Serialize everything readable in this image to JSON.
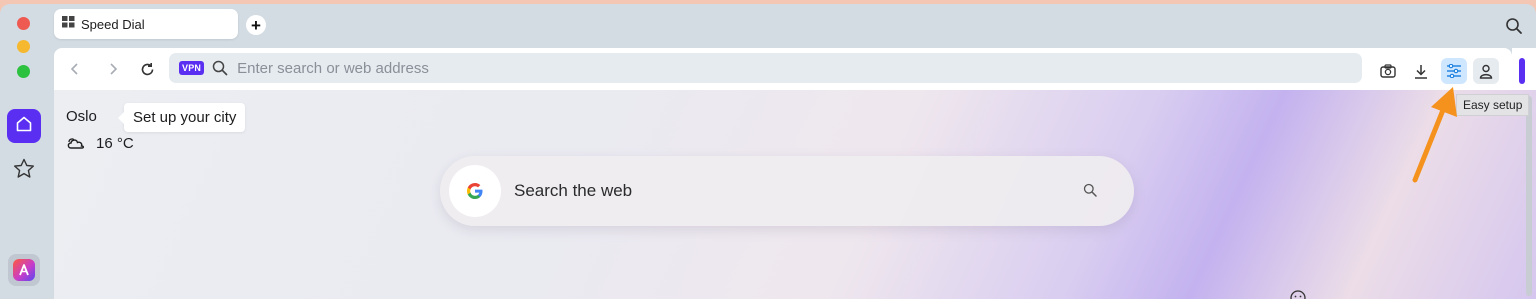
{
  "window": {
    "traffic_lights": [
      "close",
      "minimize",
      "zoom"
    ]
  },
  "tabs": [
    {
      "label": "Speed Dial",
      "icon": "grid-icon",
      "active": true
    }
  ],
  "new_tab_symbol": "+",
  "toolbar": {
    "vpn_badge": "VPN",
    "address_placeholder": "Enter search or web address"
  },
  "sidebar": {
    "items": [
      {
        "name": "home",
        "icon": "home-icon",
        "active": true
      },
      {
        "name": "bookmarks",
        "icon": "star-icon"
      },
      {
        "name": "aria",
        "icon": "aria-icon"
      }
    ]
  },
  "weather": {
    "city": "Oslo",
    "temperature": "16 °C",
    "tooltip": "Set up your city"
  },
  "search": {
    "placeholder": "Search the web",
    "engine": "Google"
  },
  "easy_setup_tooltip": "Easy setup",
  "colors": {
    "accent": "#5a2ff2",
    "arrow": "#f5921e"
  }
}
